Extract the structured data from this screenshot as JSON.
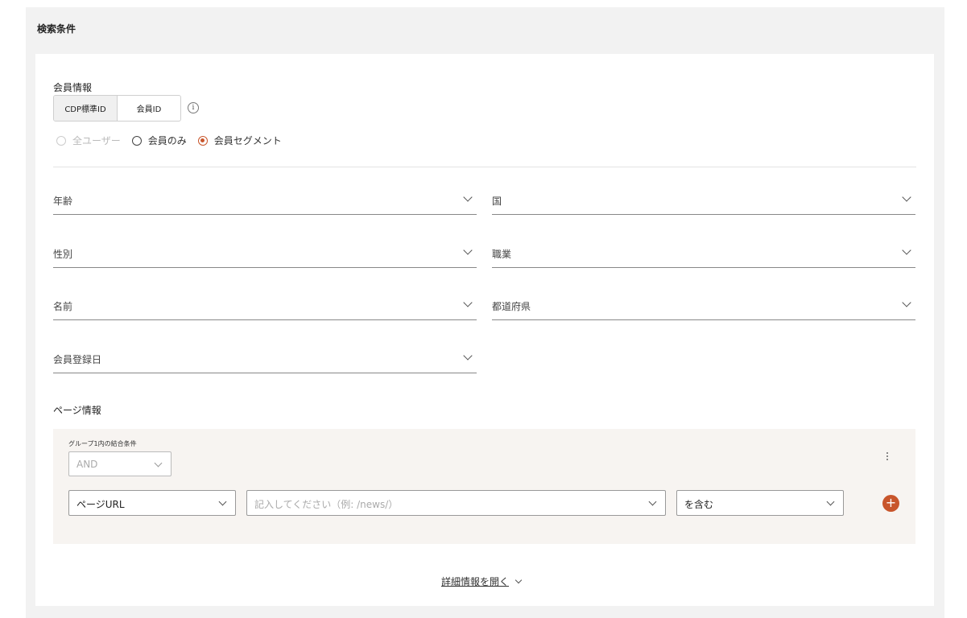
{
  "header": {
    "title": "検索条件"
  },
  "member_info": {
    "title": "会員情報",
    "id_toggle": [
      "CDP標準ID",
      "会員ID"
    ],
    "info_icon": "info-icon",
    "radios": [
      {
        "label": "全ユーザー",
        "state": "disabled"
      },
      {
        "label": "会員のみ",
        "state": "unchecked"
      },
      {
        "label": "会員セグメント",
        "state": "checked"
      }
    ],
    "fields": {
      "age": "年齢",
      "country": "国",
      "gender": "性別",
      "occupation": "職業",
      "name": "名前",
      "prefecture": "都道府県",
      "registration_date": "会員登録日"
    }
  },
  "page_info": {
    "title": "ページ情報",
    "group_label": "グループ1内の結合条件",
    "combiner": "AND",
    "condition": {
      "field": "ページURL",
      "value_placeholder": "記入してください（例: /news/）",
      "operator": "を含む"
    }
  },
  "details_link": "詳細情報を開く",
  "colors": {
    "accent": "#c8552b",
    "panel_bg": "#f2f2f2",
    "group_bg": "#f7f4f1"
  }
}
